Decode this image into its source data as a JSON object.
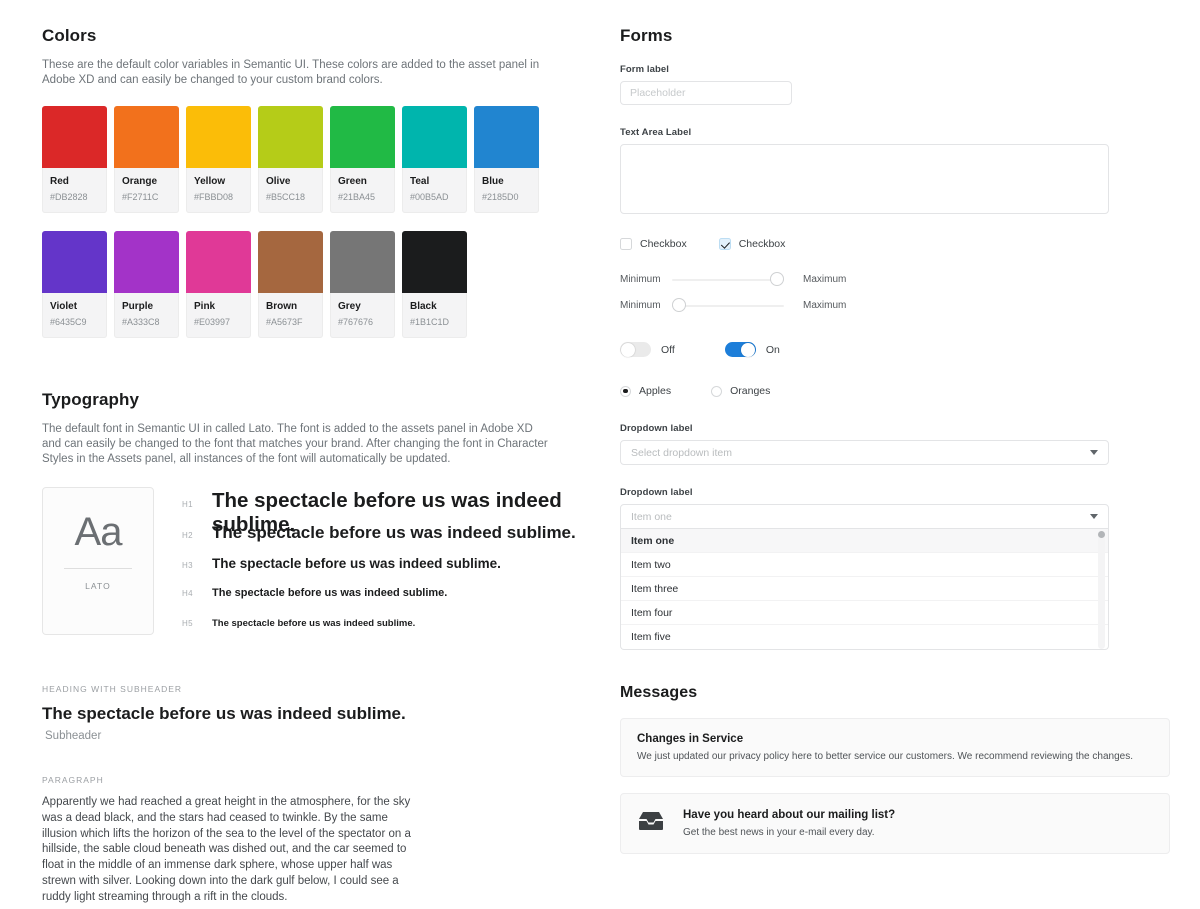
{
  "colors_section": {
    "title": "Colors",
    "description": "These are the default color variables in Semantic UI. These colors are added to the asset panel in Adobe XD and can easily be changed to your custom brand colors.",
    "swatches_row1": [
      {
        "name": "Red",
        "hex": "#DB2828"
      },
      {
        "name": "Orange",
        "hex": "#F2711C"
      },
      {
        "name": "Yellow",
        "hex": "#FBBD08"
      },
      {
        "name": "Olive",
        "hex": "#B5CC18"
      },
      {
        "name": "Green",
        "hex": "#21BA45"
      },
      {
        "name": "Teal",
        "hex": "#00B5AD"
      },
      {
        "name": "Blue",
        "hex": "#2185D0"
      }
    ],
    "swatches_row2": [
      {
        "name": "Violet",
        "hex": "#6435C9"
      },
      {
        "name": "Purple",
        "hex": "#A333C8"
      },
      {
        "name": "Pink",
        "hex": "#E03997"
      },
      {
        "name": "Brown",
        "hex": "#A5673F"
      },
      {
        "name": "Grey",
        "hex": "#767676"
      },
      {
        "name": "Black",
        "hex": "#1B1C1D"
      }
    ]
  },
  "typography_section": {
    "title": "Typography",
    "description": "The default font in Semantic UI in called Lato. The font is added to the assets panel in Adobe XD and can easily be changed to the font that matches your brand. After changing the font in Character Styles in the Assets panel, all instances of the font will automatically be updated.",
    "font_card": {
      "glyph": "Aa",
      "font_name": "LATO"
    },
    "headings": [
      {
        "tag": "H1",
        "sample": "The spectacle before us was indeed sublime."
      },
      {
        "tag": "H2",
        "sample": "The spectacle before us was indeed sublime."
      },
      {
        "tag": "H3",
        "sample": "The spectacle before us was indeed sublime."
      },
      {
        "tag": "H4",
        "sample": "The spectacle before us was indeed sublime."
      },
      {
        "tag": "H5",
        "sample": "The spectacle before us was indeed sublime."
      }
    ],
    "heading_with_subheader": {
      "eyebrow": "HEADING WITH SUBHEADER",
      "heading": "The spectacle before us was indeed sublime.",
      "subheader": "Subheader"
    },
    "paragraph_block": {
      "eyebrow": "PARAGRAPH",
      "text": "Apparently we had reached a great height in the atmosphere, for the sky was a dead black, and the stars had ceased to twinkle. By the same illusion which lifts the horizon of the sea to the level of the spectator on a hillside, the sable cloud beneath was dished out, and the car seemed to float in the middle of an immense dark sphere, whose upper half was strewn with silver. Looking down into the dark gulf below, I could see a ruddy light streaming through a rift in the clouds."
    }
  },
  "forms_section": {
    "title": "Forms",
    "form_field": {
      "label": "Form label",
      "placeholder": "Placeholder",
      "value": ""
    },
    "textarea_field": {
      "label": "Text Area Label",
      "value": ""
    },
    "checkboxes": [
      {
        "label": "Checkbox",
        "checked": false
      },
      {
        "label": "Checkbox",
        "checked": true
      }
    ],
    "sliders": [
      {
        "min_label": "Minimum",
        "max_label": "Maximum",
        "value": 100
      },
      {
        "min_label": "Minimum",
        "max_label": "Maximum",
        "value": 0
      }
    ],
    "toggles": [
      {
        "label": "Off",
        "on": false
      },
      {
        "label": "On",
        "on": true
      }
    ],
    "radios": [
      {
        "label": "Apples",
        "selected": true
      },
      {
        "label": "Oranges",
        "selected": false
      }
    ],
    "dropdown_closed": {
      "label": "Dropdown label",
      "placeholder": "Select dropdown item"
    },
    "dropdown_open": {
      "label": "Dropdown label",
      "value": "Item one",
      "items": [
        "Item one",
        "Item two",
        "Item three",
        "Item four",
        "Item five"
      ]
    }
  },
  "messages_section": {
    "title": "Messages",
    "messages": [
      {
        "icon": "",
        "title": "Changes in Service",
        "body": "We just updated our privacy policy here to better service our customers. We recommend reviewing the changes."
      },
      {
        "icon": "inbox-icon",
        "title": "Have you heard about our mailing list?",
        "body": "Get the best news in your e-mail every day."
      }
    ]
  },
  "accent_colors": {
    "toggle_on": "#1D7ED9",
    "checkbox_checked_bg": "#E3F1FB",
    "slider_fill": "#2B2C2E"
  }
}
